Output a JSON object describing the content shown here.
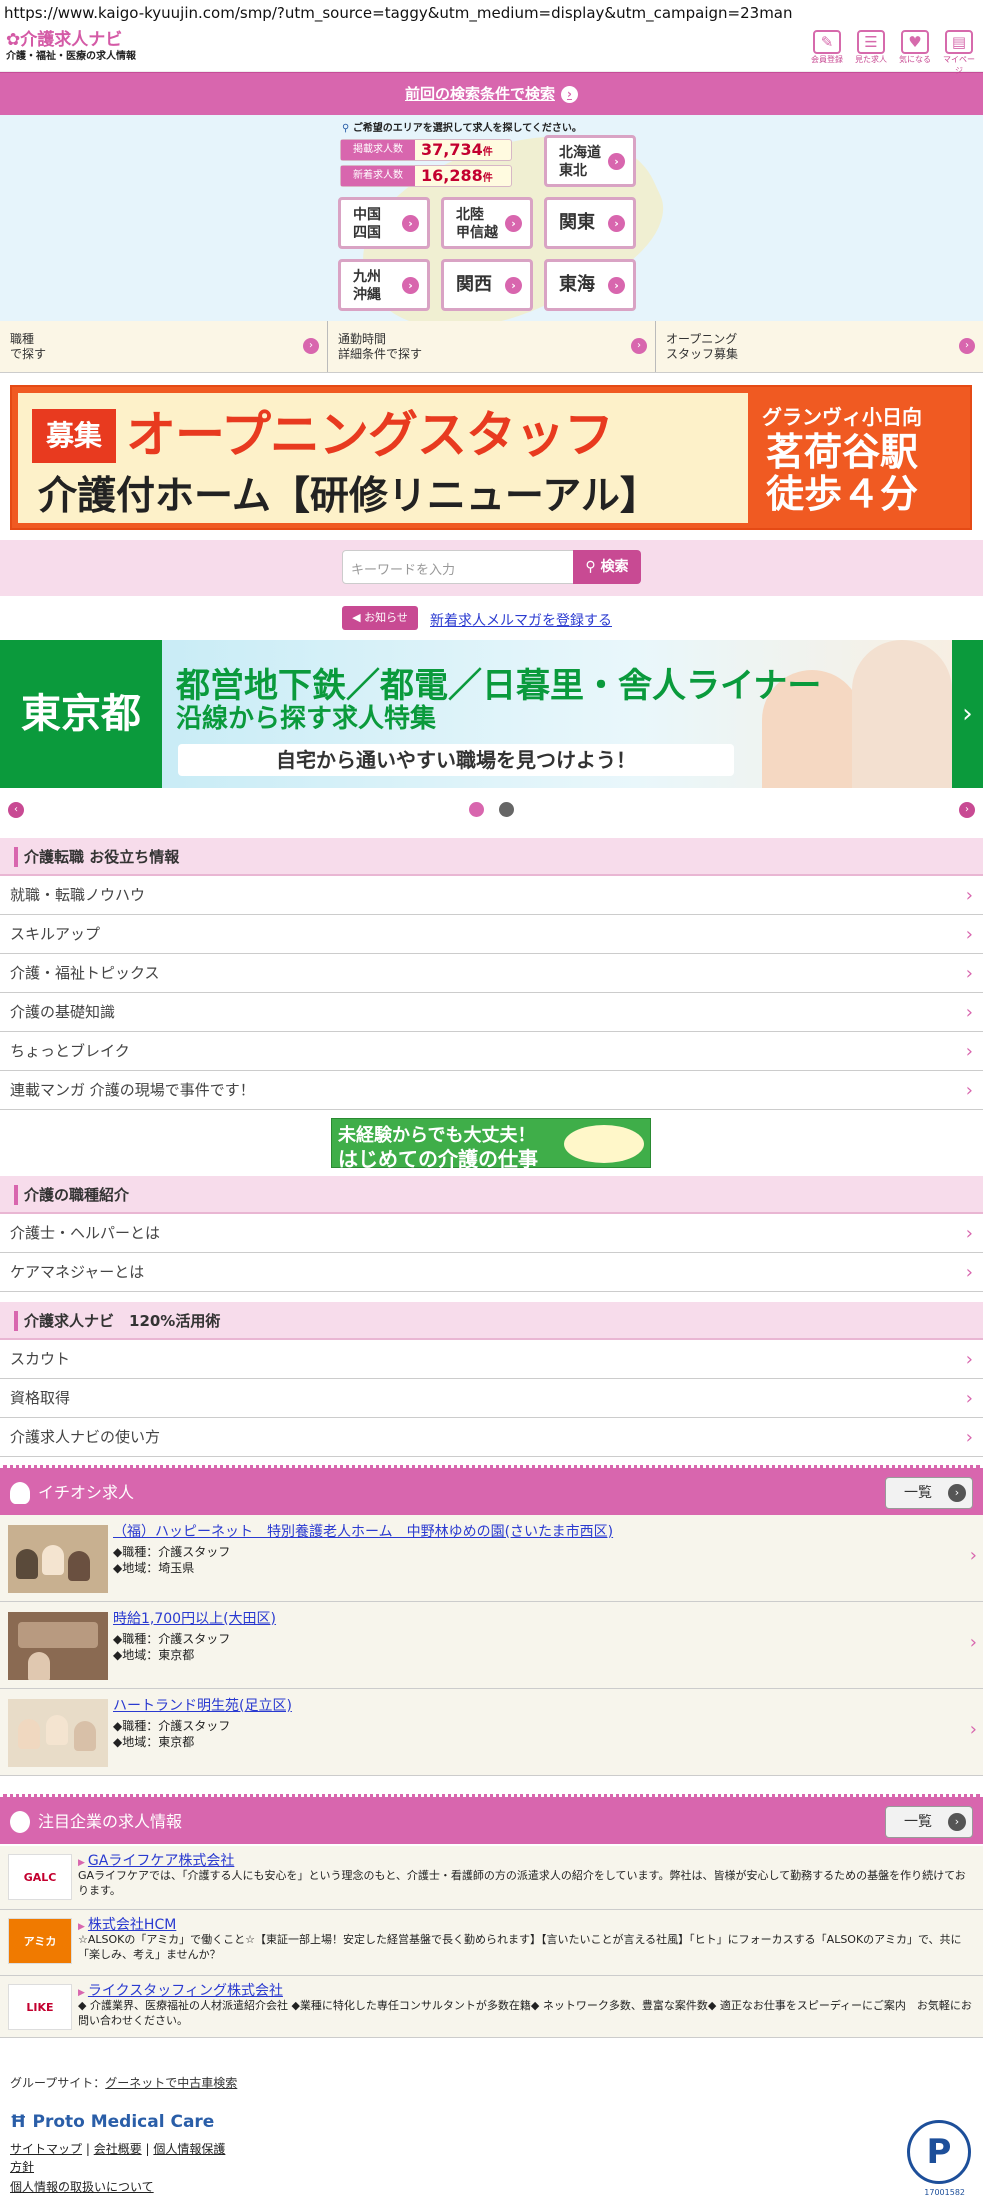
{
  "browser": {
    "url": "https://www.kaigo-kyuujin.com/smp/?utm_source=taggy&utm_medium=display&utm_campaign=23man"
  },
  "header": {
    "logo": "介護求人ナビ",
    "tagline": "介護・福祉・医療の求人情報",
    "icons": [
      {
        "label": "会員登録",
        "icon": "pencil-icon"
      },
      {
        "label": "見た求人",
        "icon": "clipboard-icon"
      },
      {
        "label": "気になる",
        "icon": "heart-icon"
      },
      {
        "label": "マイページ",
        "icon": "person-card-icon"
      }
    ]
  },
  "prev_search": {
    "label": "前回の検索条件で検索"
  },
  "area": {
    "note": "ご希望のエリアを選択して求人を探してください。",
    "counts": [
      {
        "label": "掲載求人数",
        "value": "37,734",
        "unit": "件"
      },
      {
        "label": "新着求人数",
        "value": "16,288",
        "unit": "件"
      }
    ],
    "regions": [
      {
        "line1": "北海道",
        "line2": "東北"
      },
      {
        "line1": "中国",
        "line2": "四国"
      },
      {
        "line1": "北陸",
        "line2": "甲信越"
      },
      {
        "line1": "関東",
        "line2": ""
      },
      {
        "line1": "九州",
        "line2": "沖縄"
      },
      {
        "line1": "関西",
        "line2": ""
      },
      {
        "line1": "東海",
        "line2": ""
      }
    ]
  },
  "options": [
    {
      "line1": "職種",
      "line2": "で探す"
    },
    {
      "line1": "通勤時間",
      "line2": "詳細条件で探す"
    },
    {
      "line1": "オープニング",
      "line2": "スタッフ募集"
    }
  ],
  "banner1": {
    "tag": "募集",
    "title": "オープニングスタッフ",
    "subtitle": "介護付ホーム【研修リニューアル】",
    "right1": "グランヴィ小日向",
    "right2": "茗荷谷駅",
    "right3": "徒歩４分"
  },
  "search": {
    "placeholder": "キーワードを入力",
    "button": "検索"
  },
  "notice": {
    "badge": "お知らせ",
    "link": "新着求人メルマガを登録する"
  },
  "banner2": {
    "region": "東京都",
    "line1": "都営地下鉄／都電／日暮里・舎人ライナー",
    "line2": "沿線から探す求人特集",
    "line3": "自宅から通いやすい職場を見つけよう！"
  },
  "sections": {
    "tips": {
      "title": "介護転職 お役立ち情報",
      "items": [
        "就職・転職ノウハウ",
        "スキルアップ",
        "介護・福祉トピックス",
        "介護の基礎知識",
        "ちょっとブレイク",
        "連載マンガ 介護の現場で事件です！"
      ]
    },
    "midbanner": {
      "line1": "未経験からでも大丈夫！",
      "line2": "はじめての介護の仕事"
    },
    "jobtypes": {
      "title": "介護の職種紹介",
      "items": [
        "介護士・ヘルパーとは",
        "ケアマネジャーとは"
      ]
    },
    "howto": {
      "title": "介護求人ナビ　120%活用術",
      "items": [
        "スカウト",
        "資格取得",
        "介護求人ナビの使い方"
      ]
    }
  },
  "featured": {
    "title": "イチオシ求人",
    "list_button": "一覧",
    "jobs": [
      {
        "title": "（福）ハッピーネット　特別養護老人ホーム　中野林ゆめの園(さいたま市西区)",
        "type": "◆職種：介護スタッフ",
        "area": "◆地域：埼玉県"
      },
      {
        "title": "時給1,700円以上(大田区)",
        "type": "◆職種：介護スタッフ",
        "area": "◆地域：東京都"
      },
      {
        "title": "ハートランド明生苑(足立区)",
        "type": "◆職種：介護スタッフ",
        "area": "◆地域：東京都"
      }
    ]
  },
  "companies": {
    "title": "注目企業の求人情報",
    "list_button": "一覧",
    "items": [
      {
        "logo": "GALC",
        "name": "GAライフケア株式会社",
        "desc": "GAライフケアでは、「介護する人にも安心を」という理念のもと、介護士・看護師の方の派遣求人の紹介をしています。弊社は、皆様が安心して勤務するための基盤を作り続けております。"
      },
      {
        "logo": "アミカ",
        "name": "株式会社HCM",
        "desc": "☆ALSOKの「アミカ」で働くこと☆【東証一部上場！安定した経営基盤で長く勤められます】【言いたいことが言える社風】「ヒト」にフォーカスする「ALSOKのアミカ」で、共に「楽しみ、考え」ませんか？"
      },
      {
        "logo": "LIKE",
        "name": "ライクスタッフィング株式会社",
        "desc": "◆ 介護業界、医療福祉の人材派遣紹介会社 ◆業種に特化した専任コンサルタントが多数在籍◆ ネットワーク多数、豊富な案件数◆ 適正なお仕事をスピーディーにご案内　お気軽にお問い合わせください。"
      }
    ]
  },
  "footer": {
    "group_label": "グループサイト：",
    "group_link": "グーネットで中古車検索",
    "brand": "Proto Medical Care",
    "links1": [
      "サイトマップ",
      "会社概要",
      "個人情報保護"
    ],
    "links2": "方針",
    "links3": "個人情報の取扱いについて",
    "privacy_no": "17001582"
  }
}
